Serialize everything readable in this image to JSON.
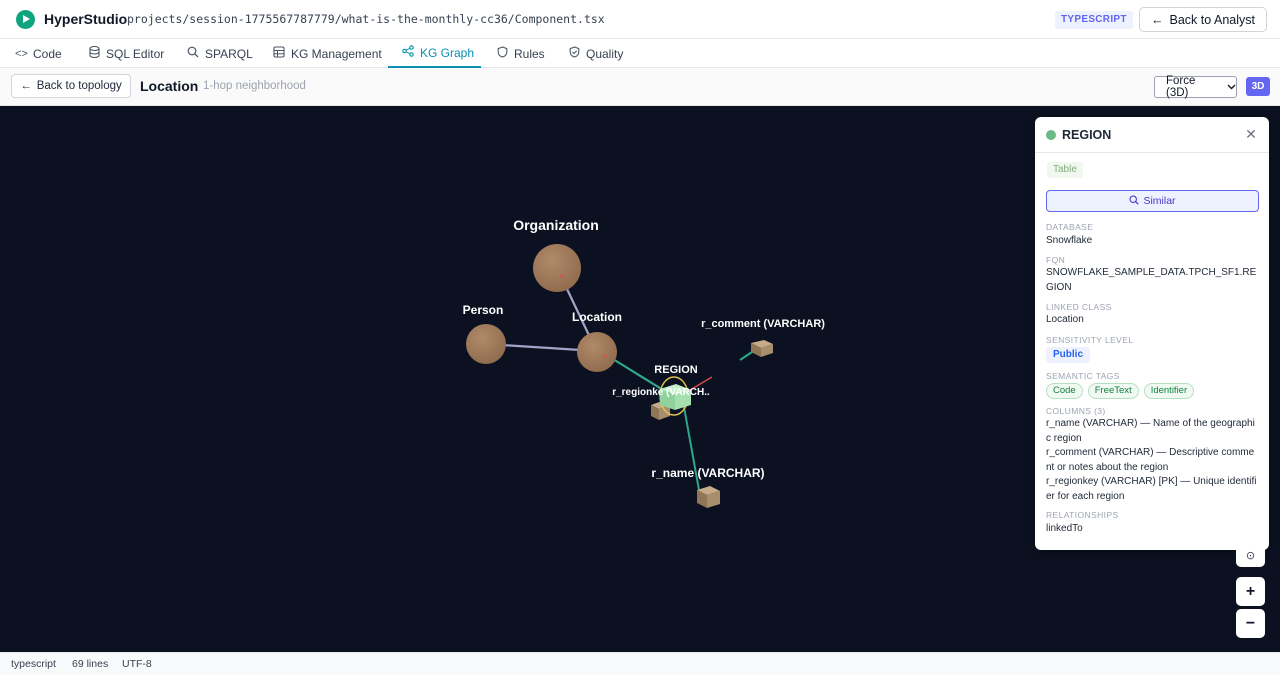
{
  "app": {
    "title": "HyperStudio",
    "file_path": "projects/session-1775567787779/what-is-the-monthly-cc36/Component.tsx",
    "language_badge": "TYPESCRIPT",
    "back_button": "Back to Analyst"
  },
  "tabs": [
    {
      "label": "Code",
      "icon": "code-icon"
    },
    {
      "label": "SQL Editor",
      "icon": "database-icon"
    },
    {
      "label": "SPARQL",
      "icon": "search-icon"
    },
    {
      "label": "KG Management",
      "icon": "table-icon"
    },
    {
      "label": "KG Graph",
      "icon": "share-icon",
      "active": true
    },
    {
      "label": "Rules",
      "icon": "shield-icon"
    },
    {
      "label": "Quality",
      "icon": "shield-check-icon"
    }
  ],
  "subheader": {
    "back_label": "Back to topology",
    "title": "Location",
    "subtitle": "1-hop neighborhood",
    "layout_select": "Force (3D)",
    "mode_badge": "3D"
  },
  "graph": {
    "nodes": {
      "organization": "Organization",
      "person": "Person",
      "location": "Location",
      "region": "REGION",
      "r_regionkey": "r_regionke (VARCH..",
      "r_comment": "r_comment (VARCHAR)",
      "r_name": "r_name (VARCHAR)"
    },
    "colors": {
      "background": "#0b1120",
      "class_node": "#a0785a",
      "column_node": "#a38a6b",
      "table_node": "#a7e0b0",
      "edge_class": "#a5a3c9",
      "edge_table": "#2ea88a"
    }
  },
  "panel": {
    "title": "REGION",
    "status_color": "#6db883",
    "type_badge": "Table",
    "similar_button": "Similar",
    "database_label": "DATABASE",
    "database_value": "Snowflake",
    "fqn_label": "FQN",
    "fqn_value": "SNOWFLAKE_SAMPLE_DATA.TPCH_SF1.REGION",
    "linked_class_label": "LINKED CLASS",
    "linked_class_value": "Location",
    "sensitivity_label": "SENSITIVITY LEVEL",
    "sensitivity_value": "Public",
    "semantic_tags_label": "SEMANTIC TAGS",
    "semantic_tags": [
      "Code",
      "FreeText",
      "Identifier"
    ],
    "columns_label": "COLUMNS (3)",
    "columns": [
      "r_name (VARCHAR) — Name of the geographic region",
      "r_comment (VARCHAR) — Descriptive comment or notes about the region",
      "r_regionkey (VARCHAR) [PK] — Unique identifier for each region"
    ],
    "relationships_label": "RELATIONSHIPS",
    "relationships_value": "linkedTo"
  },
  "controls": {
    "zoom_in": "+",
    "zoom_out": "−"
  },
  "statusbar": {
    "language": "typescript",
    "lines": "69 lines",
    "encoding": "UTF-8"
  }
}
